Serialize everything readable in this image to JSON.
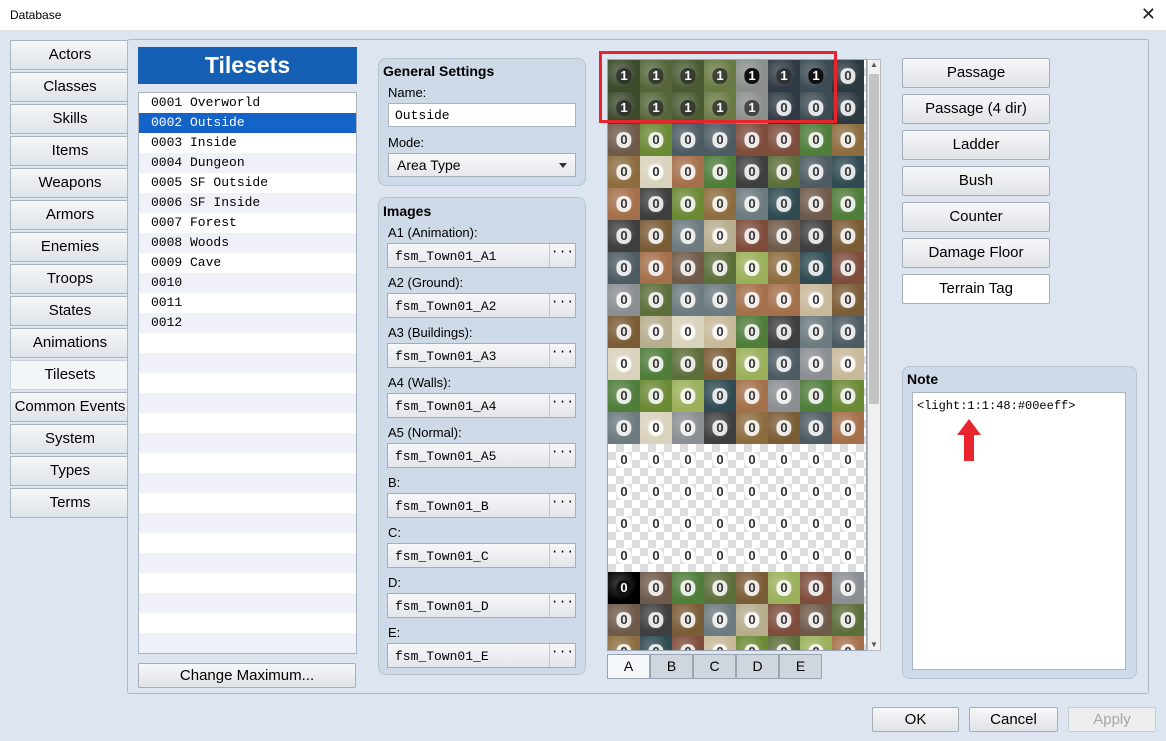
{
  "window": {
    "title": "Database",
    "close_glyph": "✕"
  },
  "nav": [
    "Actors",
    "Classes",
    "Skills",
    "Items",
    "Weapons",
    "Armors",
    "Enemies",
    "Troops",
    "States",
    "Animations",
    "Tilesets",
    "Common Events",
    "System",
    "Types",
    "Terms"
  ],
  "nav_selected": "Tilesets",
  "tilesets": {
    "header": "Tilesets",
    "items": [
      "0001 Overworld",
      "0002 Outside",
      "0003 Inside",
      "0004 Dungeon",
      "0005 SF Outside",
      "0006 SF Inside",
      "0007 Forest",
      "0008 Woods",
      "0009 Cave",
      "0010",
      "0011",
      "0012"
    ],
    "selected": "0002 Outside",
    "change_max_label": "Change Maximum..."
  },
  "general": {
    "title": "General Settings",
    "name_label": "Name:",
    "name_value": "Outside",
    "mode_label": "Mode:",
    "mode_value": "Area Type"
  },
  "images": {
    "title": "Images",
    "slots": [
      {
        "label": "A1 (Animation):",
        "value": "fsm_Town01_A1"
      },
      {
        "label": "A2 (Ground):",
        "value": "fsm_Town01_A2"
      },
      {
        "label": "A3 (Buildings):",
        "value": "fsm_Town01_A3"
      },
      {
        "label": "A4 (Walls):",
        "value": "fsm_Town01_A4"
      },
      {
        "label": "A5 (Normal):",
        "value": "fsm_Town01_A5"
      },
      {
        "label": "B:",
        "value": "fsm_Town01_B"
      },
      {
        "label": "C:",
        "value": "fsm_Town01_C"
      },
      {
        "label": "D:",
        "value": "fsm_Town01_D"
      },
      {
        "label": "E:",
        "value": "fsm_Town01_E"
      }
    ],
    "dots": "···"
  },
  "tile_tabs": [
    "A",
    "B",
    "C",
    "D",
    "E"
  ],
  "tile_tab_selected": "A",
  "flags": [
    "Passage",
    "Passage (4 dir)",
    "Ladder",
    "Bush",
    "Counter",
    "Damage Floor",
    "Terrain Tag"
  ],
  "flag_selected": "Terrain Tag",
  "note": {
    "title": "Note",
    "text": "<light:1:1:48:#00eeff>"
  },
  "footer": {
    "ok": "OK",
    "cancel": "Cancel",
    "apply": "Apply"
  },
  "colors": {
    "selection": "#1363c9",
    "header": "#1560b4",
    "highlight": "#e8242c",
    "arrow": "#e8242c"
  },
  "scroll_arrows": {
    "up": "▲",
    "down": "▼"
  }
}
